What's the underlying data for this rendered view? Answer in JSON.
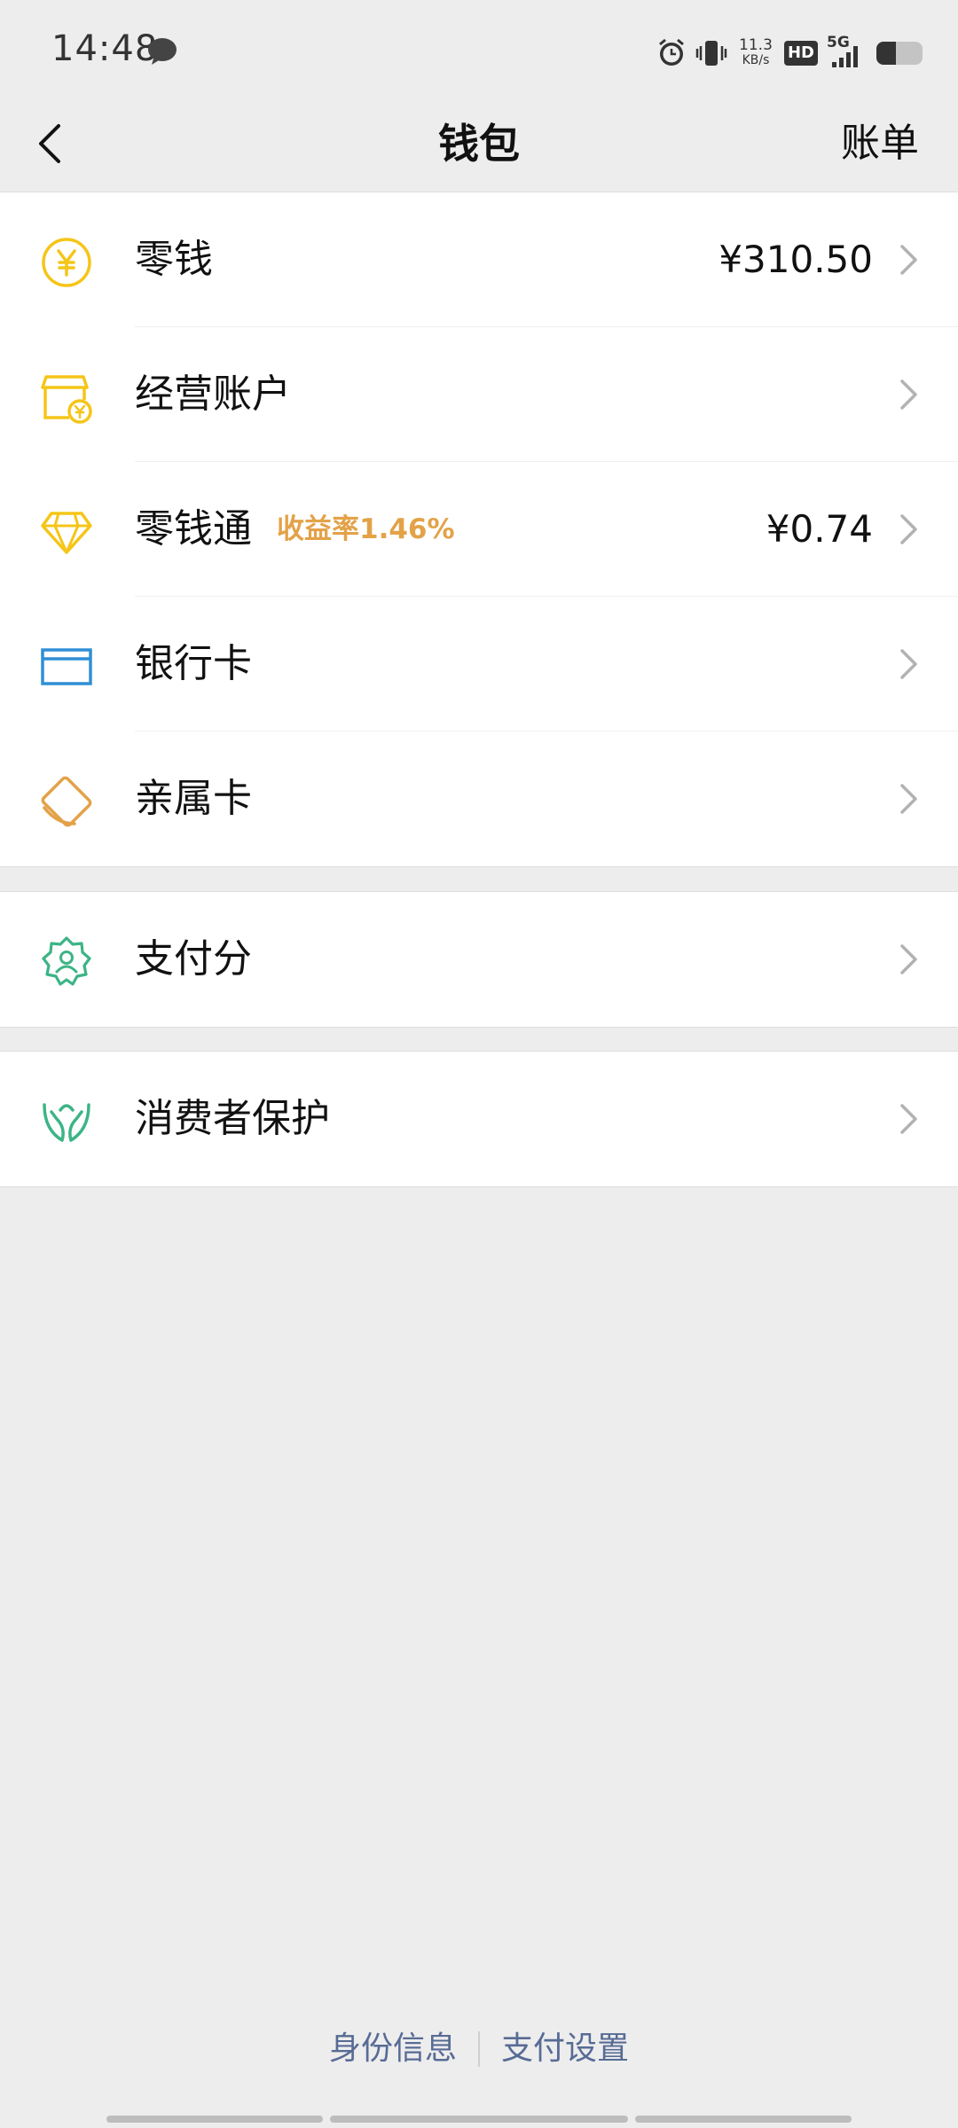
{
  "status_bar": {
    "time": "14:48",
    "speed_value": "11.3",
    "speed_unit": "KB/s",
    "hd_label": "HD",
    "network_label": "5G"
  },
  "nav": {
    "title": "钱包",
    "right_label": "账单"
  },
  "wallet_items": [
    {
      "label": "零钱",
      "value": "¥310.50",
      "icon": "yuan-coin-icon",
      "color": "#f5c518"
    },
    {
      "label": "经营账户",
      "icon": "shop-account-icon",
      "color": "#f5c518"
    },
    {
      "label": "零钱通",
      "badge": "收益率1.46%",
      "value": "¥0.74",
      "icon": "diamond-icon",
      "color": "#f5c518"
    },
    {
      "label": "银行卡",
      "icon": "bank-card-icon",
      "color": "#2f8fd6"
    },
    {
      "label": "亲属卡",
      "icon": "family-card-icon",
      "color": "#e3a248"
    }
  ],
  "pay_score": {
    "label": "支付分",
    "icon": "pay-score-badge-icon",
    "color": "#3cb486"
  },
  "consumer_protection": {
    "label": "消费者保护",
    "icon": "protect-hands-icon",
    "color": "#3cb486"
  },
  "footer": {
    "identity_label": "身份信息",
    "settings_label": "支付设置",
    "link_color": "#576b95"
  }
}
